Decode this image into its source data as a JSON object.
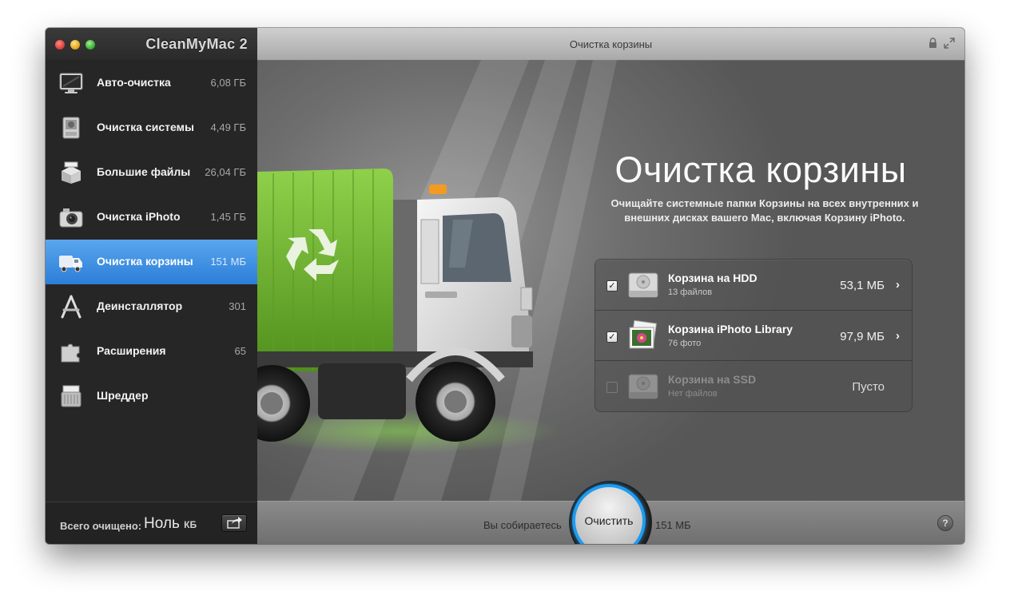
{
  "app": {
    "name": "CleanMyMac 2",
    "window_title": "Очистка корзины"
  },
  "sidebar": {
    "items": [
      {
        "label": "Авто-очистка",
        "value": "6,08 ГБ",
        "icon": "monitor-icon",
        "active": false
      },
      {
        "label": "Очистка системы",
        "value": "4,49 ГБ",
        "icon": "mac-pro-icon",
        "active": false
      },
      {
        "label": "Большие файлы",
        "value": "26,04 ГБ",
        "icon": "box-icon",
        "active": false
      },
      {
        "label": "Очистка iPhoto",
        "value": "1,45 ГБ",
        "icon": "camera-icon",
        "active": false
      },
      {
        "label": "Очистка корзины",
        "value": "151 МБ",
        "icon": "truck-icon",
        "active": true
      },
      {
        "label": "Деинсталлятор",
        "value": "301",
        "icon": "app-store-icon",
        "active": false
      },
      {
        "label": "Расширения",
        "value": "65",
        "icon": "puzzle-icon",
        "active": false
      },
      {
        "label": "Шреддер",
        "value": "",
        "icon": "shredder-icon",
        "active": false
      }
    ],
    "footer": {
      "total_label": "Всего очищено:",
      "total_value": "Ноль",
      "total_unit": "КБ"
    }
  },
  "main": {
    "hero": {
      "title": "Очистка корзины",
      "description": "Очищайте системные папки Корзины на всех внутренних и внешних дисках вашего Mac, включая Корзину iPhoto."
    },
    "trash_items": [
      {
        "name": "Корзина на HDD",
        "sub": "13 файлов",
        "size": "53,1 МБ",
        "checked": true,
        "enabled": true,
        "icon": "hard-drive-icon"
      },
      {
        "name": "Корзина iPhoto Library",
        "sub": "76 фото",
        "size": "97,9 МБ",
        "checked": true,
        "enabled": true,
        "icon": "iphoto-library-icon"
      },
      {
        "name": "Корзина на SSD",
        "sub": "Нет файлов",
        "size": "Пусто",
        "checked": false,
        "enabled": false,
        "icon": "ssd-drive-icon"
      }
    ],
    "bottom": {
      "collect_label": "Вы собираетесь",
      "clean_button": "Очистить",
      "collect_value": "151 МБ",
      "help": "?"
    }
  },
  "colors": {
    "accent": "#2b7ed8",
    "ring": "#1e9bf0",
    "truck_green": "#74b72e"
  }
}
